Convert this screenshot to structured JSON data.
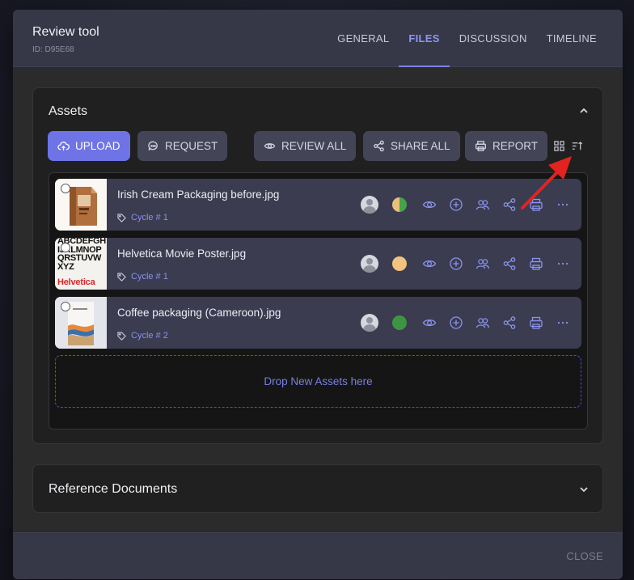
{
  "modal": {
    "title": "Review tool",
    "id_label": "ID: D95E68",
    "tabs": [
      "GENERAL",
      "FILES",
      "DISCUSSION",
      "TIMELINE"
    ],
    "active_tab": "FILES",
    "close_label": "CLOSE"
  },
  "assets": {
    "title": "Assets",
    "buttons": {
      "upload": "UPLOAD",
      "request": "REQUEST",
      "review_all": "REVIEW ALL",
      "share_all": "SHARE ALL",
      "report": "REPORT"
    },
    "view_icons": [
      "grid-view-icon",
      "sort-ascending-icon"
    ],
    "files": [
      {
        "name": "Irish Cream Packaging before.jpg",
        "cycle": "Cycle # 1",
        "status": "split",
        "status_colors": [
          "#e9c07a",
          "#46a34b"
        ]
      },
      {
        "name": "Helvetica Movie Poster.jpg",
        "cycle": "Cycle # 1",
        "status": "pending",
        "status_colors": [
          "#f2c27f"
        ]
      },
      {
        "name": "Coffee packaging (Cameroon).jpg",
        "cycle": "Cycle # 2",
        "status": "approved",
        "status_colors": [
          "#3f9443"
        ]
      }
    ],
    "row_actions": [
      "avatar",
      "status-dot",
      "eye-icon",
      "plus-circle-icon",
      "users-icon",
      "share-icon",
      "print-icon",
      "more-icon"
    ],
    "drop_label": "Drop New Assets here",
    "thumbnail_texts": {
      "helvetica": [
        "ABCDEFGHIJKLMNOPQRSTUVWXYZ",
        "Helvetica"
      ]
    }
  },
  "reference": {
    "title": "Reference Documents"
  },
  "colors": {
    "accent": "#6e73e6",
    "annotation_arrow": "#e3231f"
  }
}
